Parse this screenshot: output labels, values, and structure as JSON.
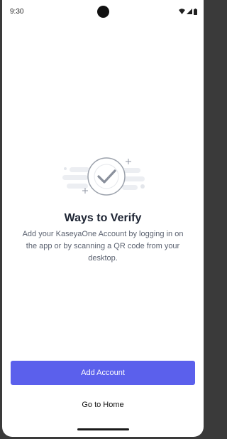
{
  "status_bar": {
    "time": "9:30",
    "icons": [
      "wifi-icon",
      "signal-icon",
      "battery-icon"
    ]
  },
  "content": {
    "illustration_icon": "checkmark-circle-icon",
    "title": "Ways to Verify",
    "description": "Add your KaseyaOne Account by logging in on the app or by scanning a QR code from your desktop."
  },
  "actions": {
    "add_account_label": "Add Account",
    "go_home_label": "Go to Home"
  },
  "colors": {
    "primary": "#5b60ec",
    "title": "#1d2433",
    "body_text": "#5b6270"
  }
}
